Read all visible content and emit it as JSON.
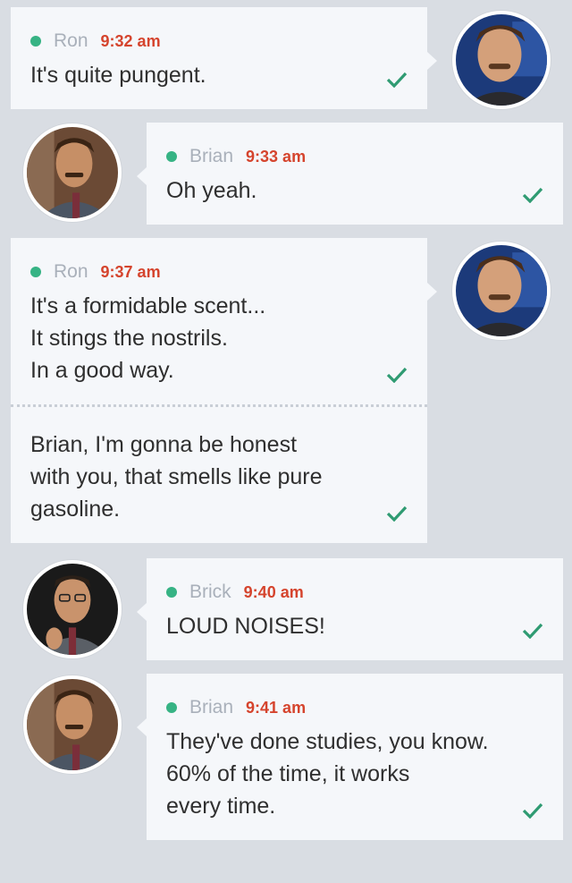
{
  "messages": [
    {
      "sender": "Ron",
      "time": "9:32 am",
      "texts": [
        "It's quite pungent."
      ]
    },
    {
      "sender": "Brian",
      "time": "9:33 am",
      "texts": [
        "Oh yeah."
      ]
    },
    {
      "sender": "Ron",
      "time": "9:37 am",
      "texts": [
        "It's a formidable scent...\nIt stings the nostrils.\nIn a good way.",
        "Brian, I'm gonna be honest\nwith you, that smells like pure\ngasoline."
      ]
    },
    {
      "sender": "Brick",
      "time": "9:40 am",
      "texts": [
        "LOUD NOISES!"
      ]
    },
    {
      "sender": "Brian",
      "time": "9:41 am",
      "texts": [
        "They've done studies, you know.\n60% of the time, it works\nevery time."
      ]
    }
  ],
  "colors": {
    "online": "#36b384",
    "timestamp": "#d5442d",
    "check": "#2f9b72",
    "sender": "#a9b0ba"
  },
  "icons": {
    "status": "online-dot-icon",
    "delivered": "checkmark-icon"
  }
}
